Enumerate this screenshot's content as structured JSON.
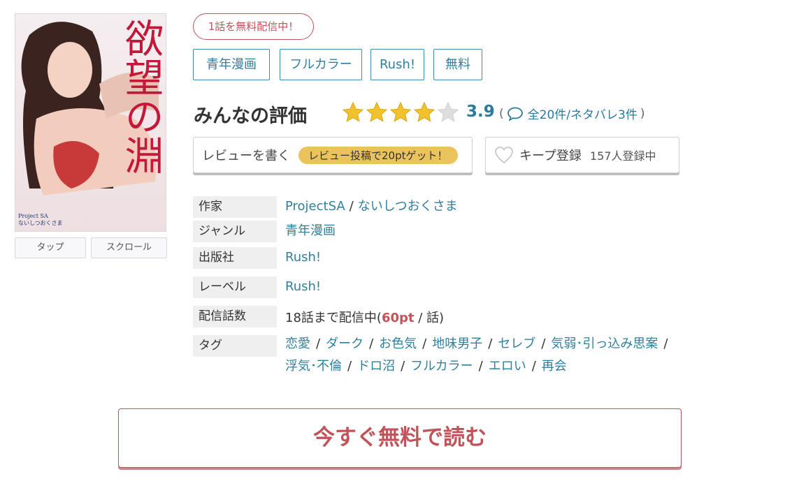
{
  "cover": {
    "title": "欲望の淵",
    "credit_line1": "Project SA",
    "credit_line2": "ないしつおくさま"
  },
  "view_buttons": {
    "tap": "タップ",
    "scroll": "スクロール"
  },
  "free_badge": "1話を無料配信中！",
  "tags": [
    "青年漫画",
    "フルカラー",
    "Rush!",
    "無料"
  ],
  "rating": {
    "title": "みんなの評価",
    "score": "3.9",
    "stars_filled": 4,
    "stars_total": 5,
    "paren_open": "(",
    "reviews": "全20件/ネタバレ3件",
    "paren_close": ")"
  },
  "review_button": {
    "label": "レビューを書く",
    "promo": "レビュー投稿で20ptゲット！"
  },
  "keep_button": {
    "label": "キープ登録",
    "count": "157人登録中"
  },
  "info": {
    "author_label": "作家",
    "authors": [
      "ProjectSA",
      "ないしつおくさま"
    ],
    "genre_label": "ジャンル",
    "genre": "青年漫画",
    "publisher_label": "出版社",
    "publisher": "Rush!",
    "label_label": "レーベル",
    "label": "Rush!",
    "episodes_label": "配信話数",
    "episodes_prefix": "18話まで配信中(",
    "episodes_pt": "60pt",
    "episodes_suffix": " / 話)",
    "tags_label": "タグ",
    "tags_line1": [
      "恋愛",
      "ダーク",
      "お色気",
      "地味男子",
      "セレブ",
      "気弱･引っ込み思案"
    ],
    "tags_line2": [
      "浮気･不倫",
      "ドロ沼",
      "フルカラー",
      "エロい",
      "再会"
    ]
  },
  "cta": "今すぐ無料で読む",
  "colors": {
    "accent": "#c0545a",
    "link": "#2f7f9e",
    "star": "#f2c12e",
    "promo": "#eac35c"
  }
}
